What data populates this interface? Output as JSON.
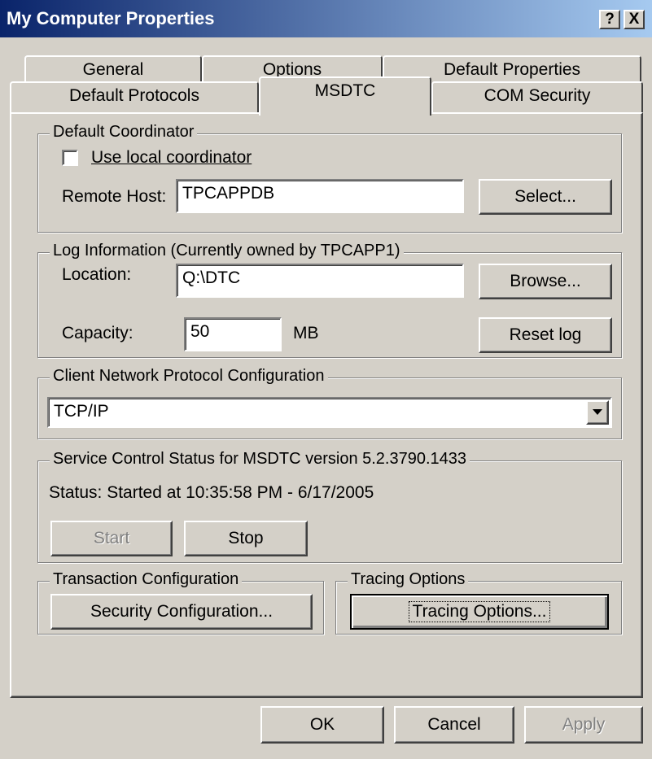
{
  "window": {
    "title": "My Computer Properties",
    "help_button": "?",
    "close_button": "X"
  },
  "tabs_row1": [
    {
      "label": "General"
    },
    {
      "label": "Options"
    },
    {
      "label": "Default Properties"
    }
  ],
  "tabs_row2": [
    {
      "label": "Default Protocols"
    },
    {
      "label": "MSDTC",
      "selected": true
    },
    {
      "label": "COM Security"
    }
  ],
  "default_coordinator": {
    "legend": "Default Coordinator",
    "use_local_label": "Use local coordinator",
    "use_local_checked": false,
    "remote_host_label": "Remote Host:",
    "remote_host_value": "TPCAPPDB",
    "select_button": "Select..."
  },
  "log_information": {
    "legend": "Log Information (Currently owned by TPCAPP1)",
    "location_label": "Location:",
    "location_value": "Q:\\DTC",
    "browse_button": "Browse...",
    "capacity_label": "Capacity:",
    "capacity_value": "50",
    "capacity_unit": "MB",
    "reset_button": "Reset log"
  },
  "client_network": {
    "legend": "Client Network Protocol Configuration",
    "selected_protocol": "TCP/IP"
  },
  "service_control": {
    "legend": "Service Control Status for MSDTC version 5.2.3790.1433",
    "status_text": "Status: Started at 10:35:58 PM - 6/17/2005",
    "start_button": "Start",
    "start_enabled": false,
    "stop_button": "Stop"
  },
  "transaction_config": {
    "legend": "Transaction Configuration",
    "security_button": "Security Configuration..."
  },
  "tracing": {
    "legend": "Tracing Options",
    "tracing_button": "Tracing Options..."
  },
  "dialog_buttons": {
    "ok": "OK",
    "cancel": "Cancel",
    "apply": "Apply",
    "apply_enabled": false
  },
  "colors": {
    "face": "#d4d0c8",
    "title_start": "#0a246a",
    "title_end": "#a6caf0",
    "disabled_text": "#808080"
  }
}
